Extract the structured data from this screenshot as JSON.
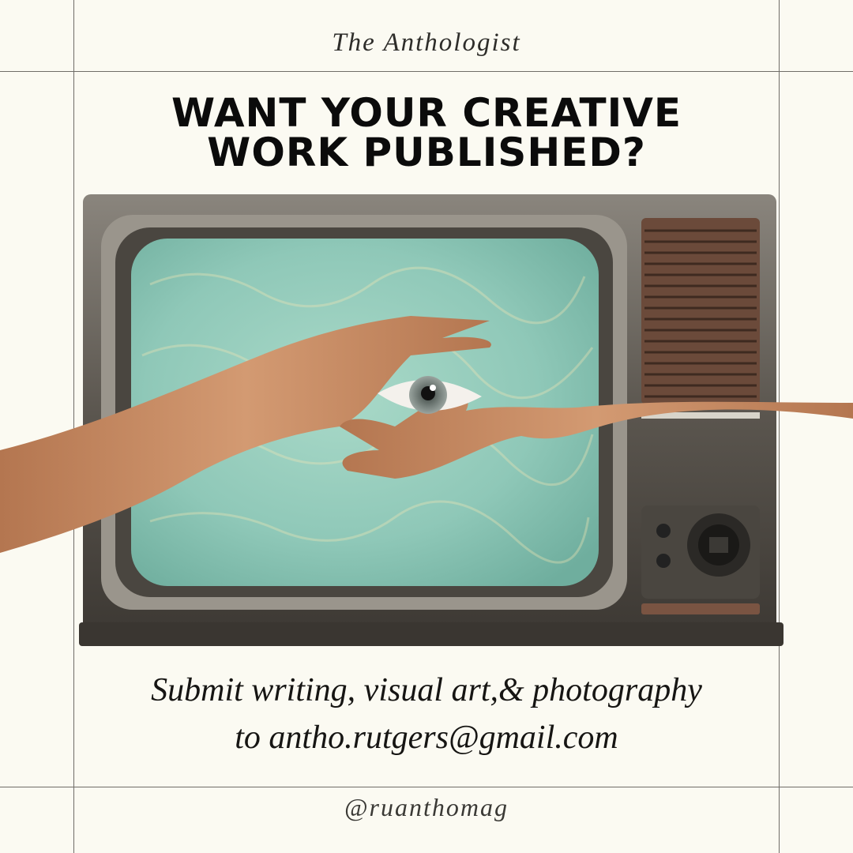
{
  "brand": {
    "name": "The Anthologist"
  },
  "headline": {
    "line1": "WANT YOUR CREATIVE",
    "line2": "WORK PUBLISHED?"
  },
  "illustration": {
    "subject": "retro-television-with-hands-framing-eye",
    "colors": {
      "tv_body": "#5a554e",
      "screen": "#8fc8b8",
      "skin": "#c89069",
      "iris": "#7f8b86"
    }
  },
  "cta": {
    "line1": "Submit writing, visual art,& photography",
    "line2": "to antho.rutgers@gmail.com"
  },
  "social": {
    "handle": "@ruanthomag"
  },
  "colors": {
    "background": "#fbfaf2",
    "frame_lines": "#6f6d68",
    "text": "#111111"
  }
}
